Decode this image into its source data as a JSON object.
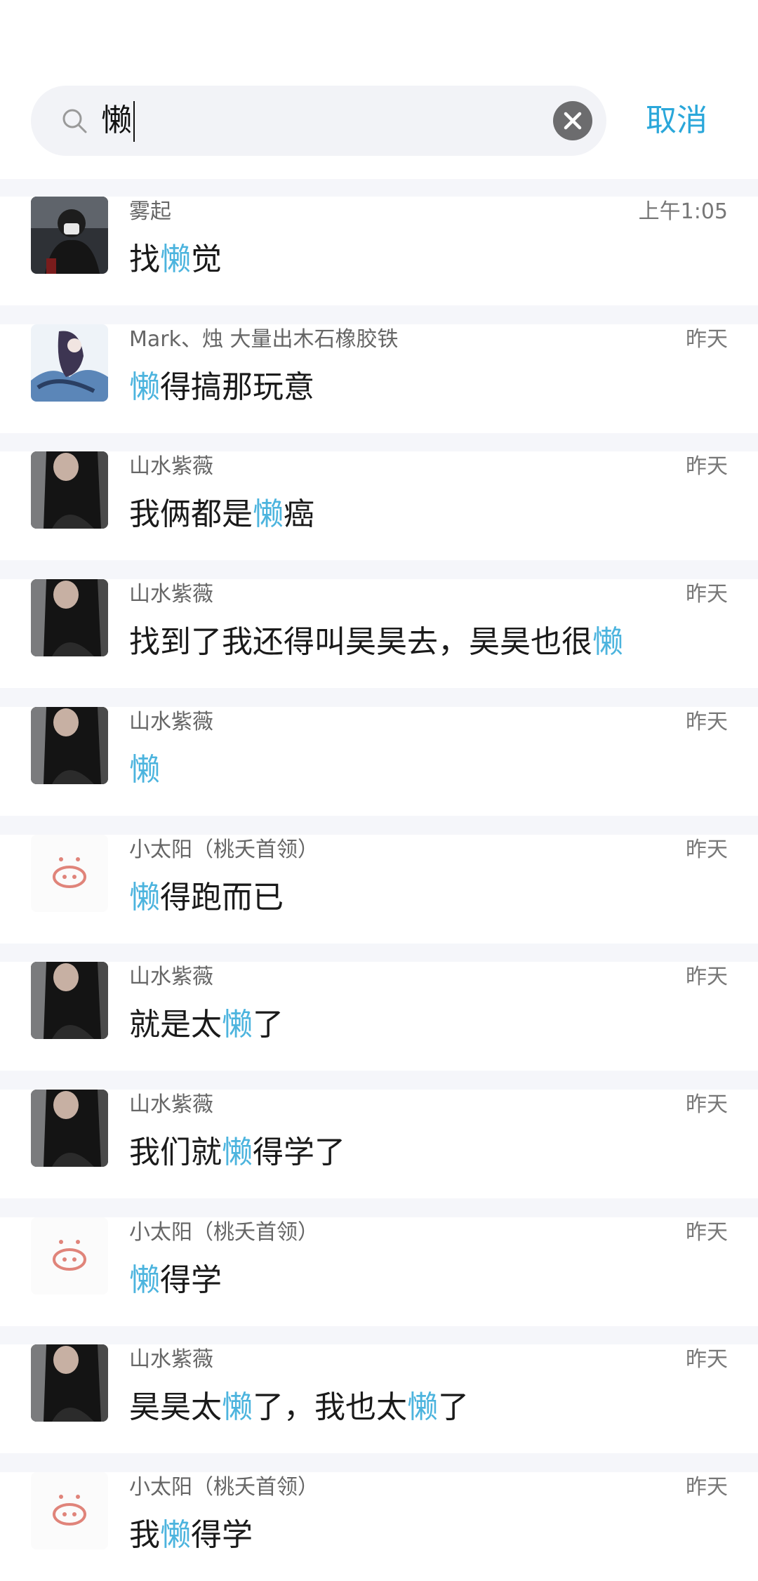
{
  "search": {
    "query": "懒",
    "cancel_label": "取消"
  },
  "colors": {
    "highlight": "#4cb4de",
    "accent": "#2aa7da"
  },
  "results": [
    {
      "avatar": "avatar-man",
      "name": "雾起",
      "time": "上午1:05",
      "segments": [
        "找",
        "懒",
        "觉"
      ]
    },
    {
      "avatar": "avatar-anime",
      "name": "Mark、烛  大量出木石橡胶铁",
      "time": "昨天",
      "segments": [
        "",
        "懒",
        "得搞那玩意"
      ]
    },
    {
      "avatar": "avatar-woman",
      "name": "山水紫薇",
      "time": "昨天",
      "segments": [
        "我俩都是",
        "懒",
        "癌"
      ]
    },
    {
      "avatar": "avatar-woman",
      "name": "山水紫薇",
      "time": "昨天",
      "segments": [
        "找到了我还得叫昊昊去，昊昊也很",
        "懒",
        ""
      ]
    },
    {
      "avatar": "avatar-woman",
      "name": "山水紫薇",
      "time": "昨天",
      "segments": [
        "",
        "懒",
        ""
      ]
    },
    {
      "avatar": "avatar-pig",
      "name": "小太阳（桃夭首领）",
      "time": "昨天",
      "segments": [
        "",
        "懒",
        "得跑而已"
      ]
    },
    {
      "avatar": "avatar-woman",
      "name": "山水紫薇",
      "time": "昨天",
      "segments": [
        "就是太",
        "懒",
        "了"
      ]
    },
    {
      "avatar": "avatar-woman",
      "name": "山水紫薇",
      "time": "昨天",
      "segments": [
        "我们就",
        "懒",
        "得学了"
      ]
    },
    {
      "avatar": "avatar-pig",
      "name": "小太阳（桃夭首领）",
      "time": "昨天",
      "segments": [
        "",
        "懒",
        "得学"
      ]
    },
    {
      "avatar": "avatar-woman",
      "name": "山水紫薇",
      "time": "昨天",
      "segments": [
        "昊昊太",
        "懒",
        "了，我也太",
        "懒",
        "了"
      ]
    },
    {
      "avatar": "avatar-pig",
      "name": "小太阳（桃夭首领）",
      "time": "昨天",
      "segments": [
        "我",
        "懒",
        "得学"
      ]
    }
  ]
}
